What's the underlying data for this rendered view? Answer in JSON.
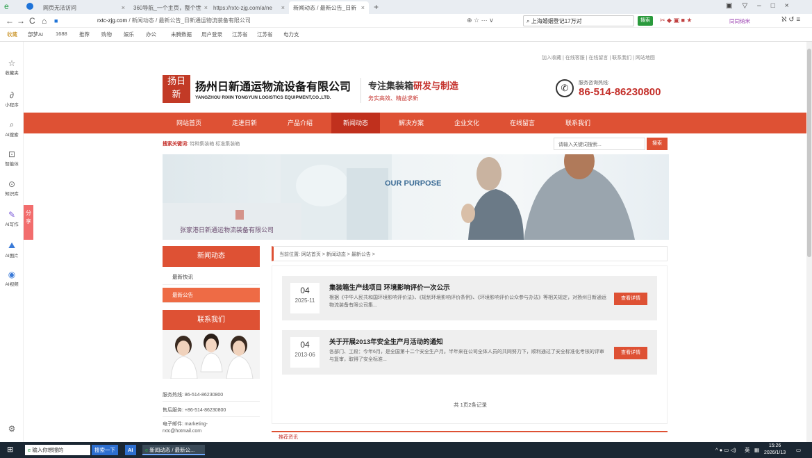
{
  "browser": {
    "tabs": [
      {
        "label": "网页无法访问"
      },
      {
        "label": "360导航_一个主页，整个世"
      },
      {
        "label": "https://rxtc-zjg.com/a/ne"
      },
      {
        "label": "新闻动态 / 最新公告_日新"
      }
    ],
    "new_tab": "+",
    "url_domain": "rxtc-zjg.com",
    "url_path": " / 新闻动态 / 最新公告_日新通运物流装备有限公司",
    "search_value": "上海婚姻登记17万对",
    "search_button": "搜索",
    "toolbar_right": "同同纳米",
    "favorites": [
      "收藏",
      "部梦AI",
      "1688",
      "推荐",
      "购物",
      "娱乐",
      "办公",
      "未腾数据",
      "用户登录",
      "江苏省",
      "江苏省",
      "电力支"
    ]
  },
  "sidebar": {
    "items": [
      {
        "icon": "star-icon",
        "label": "收藏夹"
      },
      {
        "icon": "mini-program-icon",
        "label": "小程序"
      },
      {
        "icon": "search-icon",
        "label": "AI搜索"
      },
      {
        "icon": "agent-icon",
        "label": "智能体"
      },
      {
        "icon": "knowledge-icon",
        "label": "知识库"
      },
      {
        "icon": "write-icon",
        "label": "AI写作"
      },
      {
        "icon": "image-icon",
        "label": "AI图片"
      },
      {
        "icon": "video-icon",
        "label": "AI视频"
      }
    ],
    "share": "分享"
  },
  "header": {
    "top_links": "加入收藏 | 在线客服 | 在线留言 | 联系我们 | 网站地图",
    "logo_text": "扬日新",
    "company_cn": "扬州日新通运物流设备有限公司",
    "company_en": "YANGZHOU RIXIN TONGYUN LOGISTICS EQUIPMENT,CO.,LTD.",
    "slogan_a": "专注集装箱",
    "slogan_b": "研发与制造",
    "slogan2": "务实高效、精益求新",
    "hotline_label": "服务咨询热线:",
    "hotline": "86-514-86230800"
  },
  "nav": [
    "网站首页",
    "走进日新",
    "产品介绍",
    "新闻动态",
    "解决方案",
    "企业文化",
    "在线留言",
    "联系我们"
  ],
  "keywords": {
    "label": "搜索关键词:",
    "items": "特种集装箱  标准集装箱",
    "placeholder": "请输入关键词搜索...",
    "button": "搜索"
  },
  "banner": {
    "heading": "OUR PURPOSE",
    "company": "张家港日新通运物流装备有限公司"
  },
  "left": {
    "news_head": "新闻动态",
    "links": [
      "最新快讯",
      "最新公告"
    ],
    "contact_head": "联系我们",
    "contact_rows": [
      "服务热线: 86-514-86230800",
      "售后服务: +86-514-86230800",
      "电子邮件: marketing-rxtc@hotmail.com"
    ]
  },
  "main": {
    "breadcrumb": "当前位置: 网站首页 > 新闻动态 > 最新公告 >",
    "news": [
      {
        "day": "04",
        "ym": "2025-11",
        "title": "集装箱生产线项目 环境影响评价一次公示",
        "desc": "根据《中华人民共和国环境影响评价法》、《规划环境影响评价条例》、《环境影响评价公众参与办法》等相关规定，对扬州日新通运物流装备有限公司集...",
        "button": "查看详情"
      },
      {
        "day": "04",
        "ym": "2013-06",
        "title": "关于开展2013年安全生产月活动的通知",
        "desc": "各部门、工段：今年6月，是全国第十二个安全生产月。半年来在公司全体人员的共同努力下，顺利通过了安全标准化考核的评审与复审，取得了安全标准...",
        "button": "查看详情"
      }
    ],
    "pager": "共 1页2条记录",
    "bottom_head": "推荐资讯"
  },
  "taskbar": {
    "search": "输入你想搜的",
    "search_btn": "搜索一下",
    "app": "新闻动态 / 最新公...",
    "ime": "英",
    "time": "15:26",
    "date": "2026/1/13"
  }
}
